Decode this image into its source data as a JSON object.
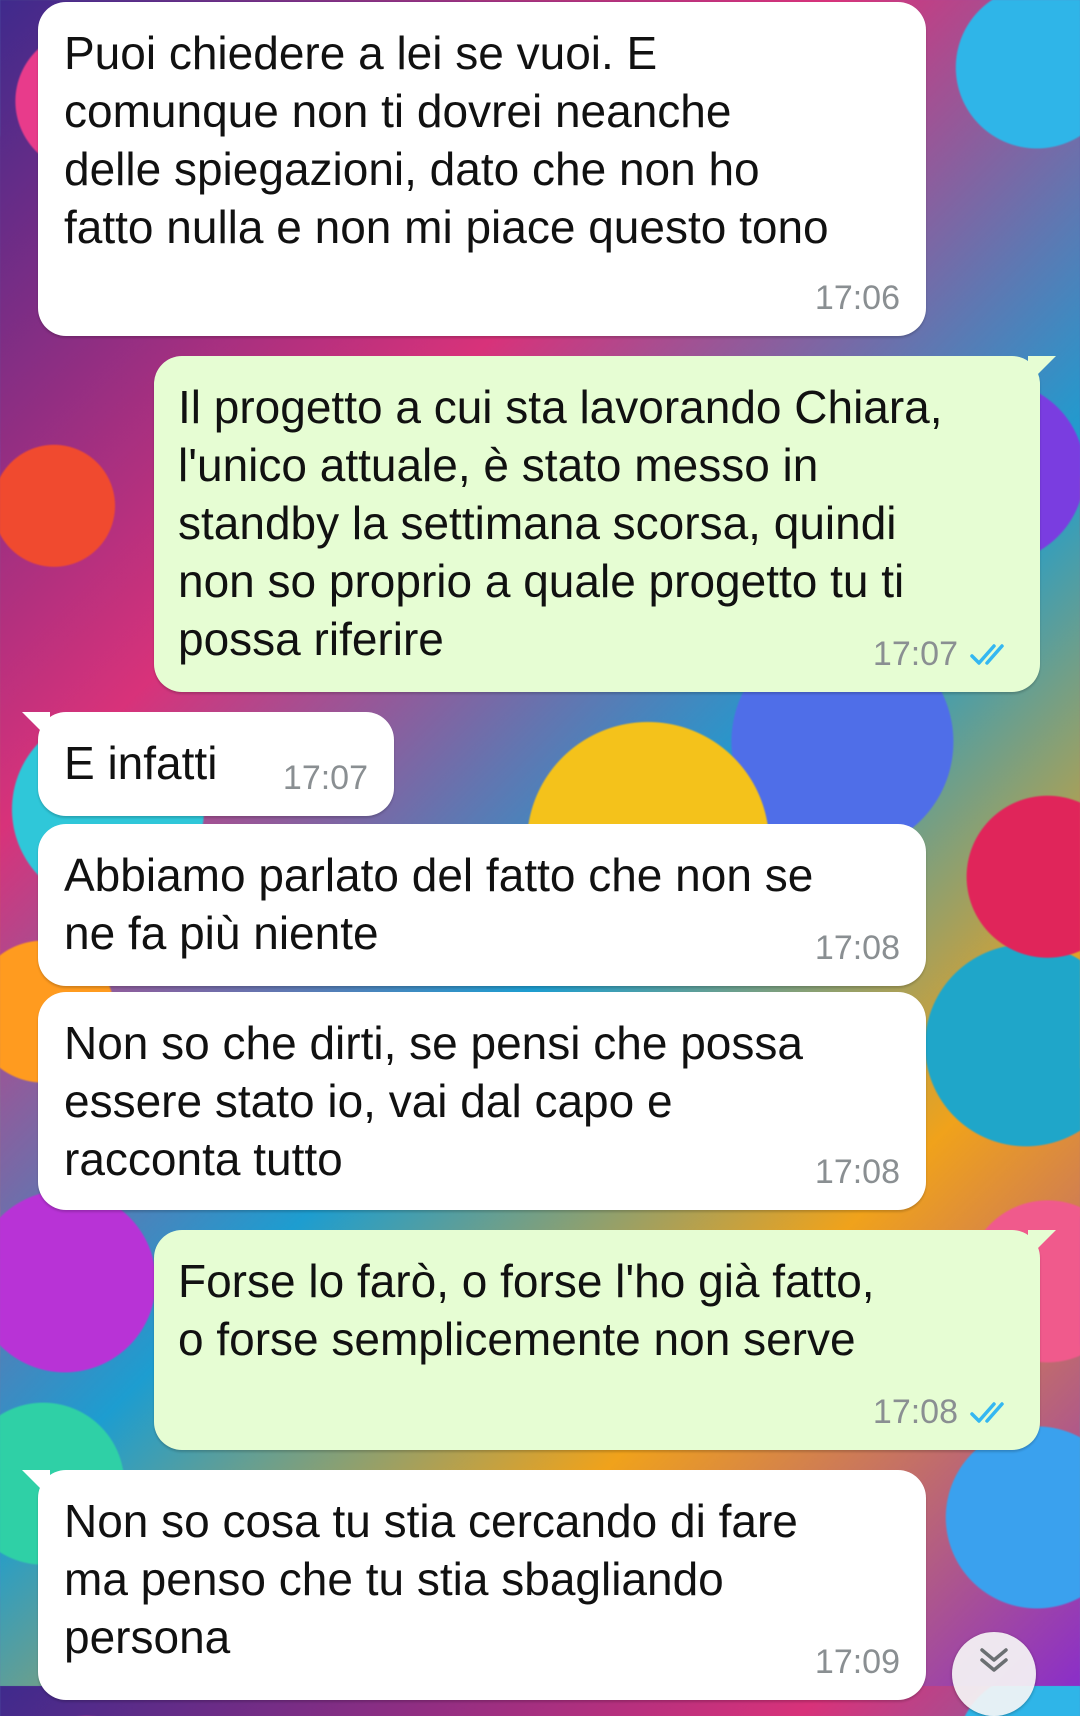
{
  "messages": [
    {
      "direction": "in",
      "text": "Puoi chiedere a lei se vuoi. E\ncomunque non ti dovrei neanche\ndelle spiegazioni, dato che non ho\nfatto nulla e non mi piace questo tono",
      "time": "17:06"
    },
    {
      "direction": "out",
      "text": "Il progetto a cui sta lavorando Chiara,\nl'unico attuale, è stato messo in\nstandby la settimana scorsa, quindi\nnon so proprio a quale progetto tu ti\npossa riferire",
      "time": "17:07",
      "status": "read"
    },
    {
      "direction": "in",
      "text": "E infatti",
      "time": "17:07"
    },
    {
      "direction": "in",
      "text": "Abbiamo parlato del fatto che non se\nne fa più niente",
      "time": "17:08"
    },
    {
      "direction": "in",
      "text": "Non so che dirti, se pensi che possa\nessere stato io, vai dal capo e\nracconta tutto",
      "time": "17:08"
    },
    {
      "direction": "out",
      "text": "Forse lo farò, o forse l'ho già fatto,\no forse semplicemente non serve",
      "time": "17:08",
      "status": "read"
    },
    {
      "direction": "in",
      "text": "Non so cosa tu stia cercando di fare\nma penso che tu stia sbagliando\npersona",
      "time": "17:09"
    }
  ],
  "colors": {
    "incoming_bubble": "#ffffff",
    "outgoing_bubble": "#e6fdd3",
    "timestamp": "#8a8f92",
    "read_ticks": "#34b7f1"
  },
  "icons": {
    "read_status": "double-check-icon",
    "scroll_down": "double-chevron-down-icon"
  }
}
